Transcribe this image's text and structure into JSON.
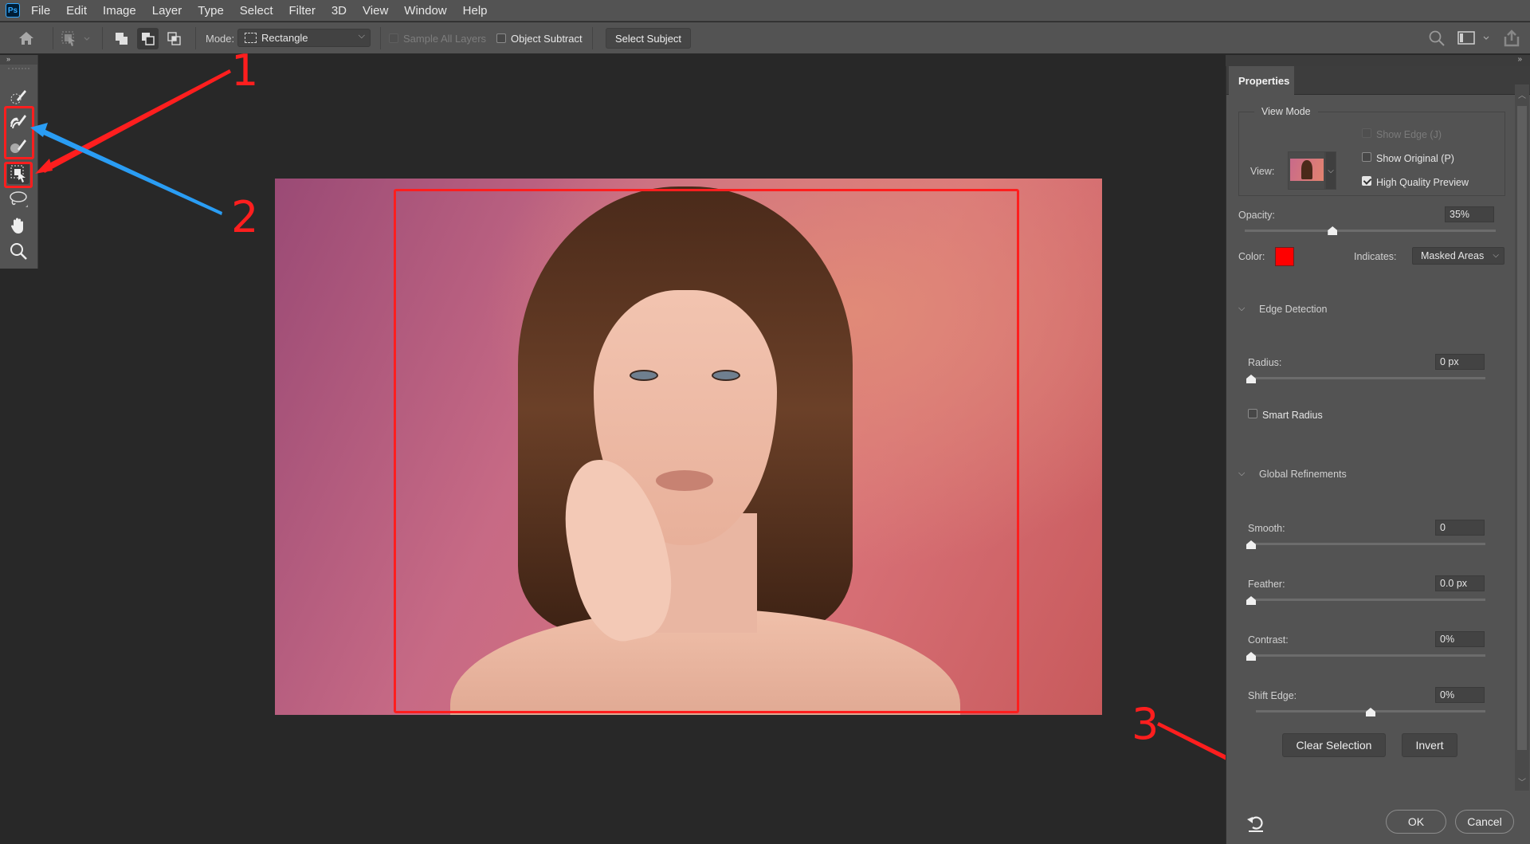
{
  "app": {
    "logo": "Ps",
    "menu": [
      "File",
      "Edit",
      "Image",
      "Layer",
      "Type",
      "Select",
      "Filter",
      "3D",
      "View",
      "Window",
      "Help"
    ]
  },
  "options_bar": {
    "mode_label": "Mode:",
    "mode_value": "Rectangle",
    "sample_all_layers": {
      "label": "Sample All Layers",
      "checked": false,
      "enabled": false
    },
    "object_subtract": {
      "label": "Object Subtract",
      "checked": false
    },
    "select_subject_label": "Select Subject",
    "icons": [
      "home-icon",
      "tool-preset-icon",
      "new-selection-icon",
      "add-to-selection-icon",
      "subtract-from-selection-icon",
      "search-icon",
      "workspace-icon",
      "share-icon"
    ]
  },
  "toolbar": {
    "collapse_glyph": "»",
    "tools": [
      {
        "name": "quick-selection-tool",
        "annotated": false
      },
      {
        "name": "refine-edge-brush-tool",
        "annotated": true
      },
      {
        "name": "brush-tool",
        "annotated": true
      },
      {
        "name": "object-selection-tool",
        "annotated": true
      },
      {
        "name": "lasso-tool",
        "annotated": false
      },
      {
        "name": "hand-tool",
        "annotated": false
      },
      {
        "name": "zoom-tool",
        "annotated": false
      }
    ]
  },
  "annotations": {
    "labels": [
      "1",
      "2",
      "3"
    ],
    "colors": {
      "red": "#ff1e1e",
      "blue": "#2a9df4"
    }
  },
  "properties": {
    "tab_label": "Properties",
    "view_mode": {
      "title": "View Mode",
      "view_label": "View:",
      "show_edge": {
        "label": "Show Edge (J)",
        "checked": false,
        "enabled": false
      },
      "show_original": {
        "label": "Show Original (P)",
        "checked": false
      },
      "high_quality_preview": {
        "label": "High Quality Preview",
        "checked": true
      }
    },
    "opacity": {
      "label": "Opacity:",
      "value": "35%",
      "fraction": 0.35
    },
    "color": {
      "label": "Color:",
      "value": "#ff0000"
    },
    "indicates": {
      "label": "Indicates:",
      "value": "Masked Areas"
    },
    "edge_detection": {
      "title": "Edge Detection",
      "radius": {
        "label": "Radius:",
        "value": "0 px",
        "fraction": 0
      },
      "smart_radius": {
        "label": "Smart Radius",
        "checked": false
      }
    },
    "global_refinements": {
      "title": "Global Refinements",
      "smooth": {
        "label": "Smooth:",
        "value": "0",
        "fraction": 0
      },
      "feather": {
        "label": "Feather:",
        "value": "0.0 px",
        "fraction": 0
      },
      "contrast": {
        "label": "Contrast:",
        "value": "0%",
        "fraction": 0
      },
      "shift_edge": {
        "label": "Shift Edge:",
        "value": "0%",
        "fraction": 0.5
      }
    },
    "buttons": {
      "clear_selection": "Clear Selection",
      "invert": "Invert",
      "ok": "OK",
      "cancel": "Cancel"
    }
  }
}
